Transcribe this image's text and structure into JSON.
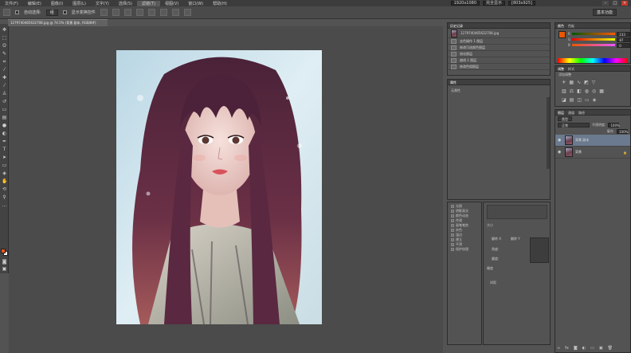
{
  "menubar": {
    "items": [
      "文件(F)",
      "编辑(E)",
      "图像(I)",
      "图层(L)",
      "文字(Y)",
      "选择(S)",
      "滤镜(T)",
      "视图(V)",
      "窗口(W)",
      "帮助(H)"
    ],
    "size_w": "1920x1080",
    "size_field2": "完全显示",
    "size_field3": "[803x925]"
  },
  "options": {
    "auto_select_label": "自动选择:",
    "auto_select_value": "组",
    "show_transform_label": "显示变换控件",
    "workspace": "基本功能"
  },
  "document": {
    "tab_title": "1279740465632708.jpg @ 74.5% (背景 副本, RGB/8#)"
  },
  "history": {
    "tabs": [
      "历史记录"
    ],
    "snapshot": "1279740465632708.jpg",
    "items": [
      "去色操作 1 图层",
      "修改可选颜色图层",
      "锐化图层",
      "曲线 1 图层",
      "修改色相图层"
    ]
  },
  "properties": {
    "tabs": [
      "属性"
    ],
    "label": "无属性"
  },
  "color": {
    "tabs": [
      "颜色",
      "色板"
    ],
    "r": "233",
    "g": "87",
    "b": "0",
    "r_label": "R",
    "g_label": "G",
    "b_label": "B"
  },
  "adjustments": {
    "tabs": [
      "调整",
      "样式"
    ],
    "label": "添加调整"
  },
  "layers": {
    "tabs": [
      "图层",
      "通道",
      "路径"
    ],
    "kind": "类型",
    "blend_mode": "正常",
    "opacity_label": "不透明度:",
    "opacity": "100%",
    "fill_label": "填充:",
    "fill": "100%",
    "items": [
      {
        "name": "背景 副本",
        "selected": true
      },
      {
        "name": "背景",
        "selected": false
      }
    ]
  },
  "brush_list": {
    "items": [
      "光照",
      "阴影高光",
      "颜色动态",
      "传递",
      "画笔笔势",
      "杂色",
      "湿边",
      "建立",
      "平滑",
      "保护纹理"
    ]
  },
  "brush_opts": {
    "size_label": "大小",
    "flip_x": "翻转 X",
    "flip_y": "翻转 Y",
    "angle_label": "角度:",
    "roundness_label": "圆度:",
    "hardness_label": "硬度",
    "spacing_label": "间距"
  }
}
